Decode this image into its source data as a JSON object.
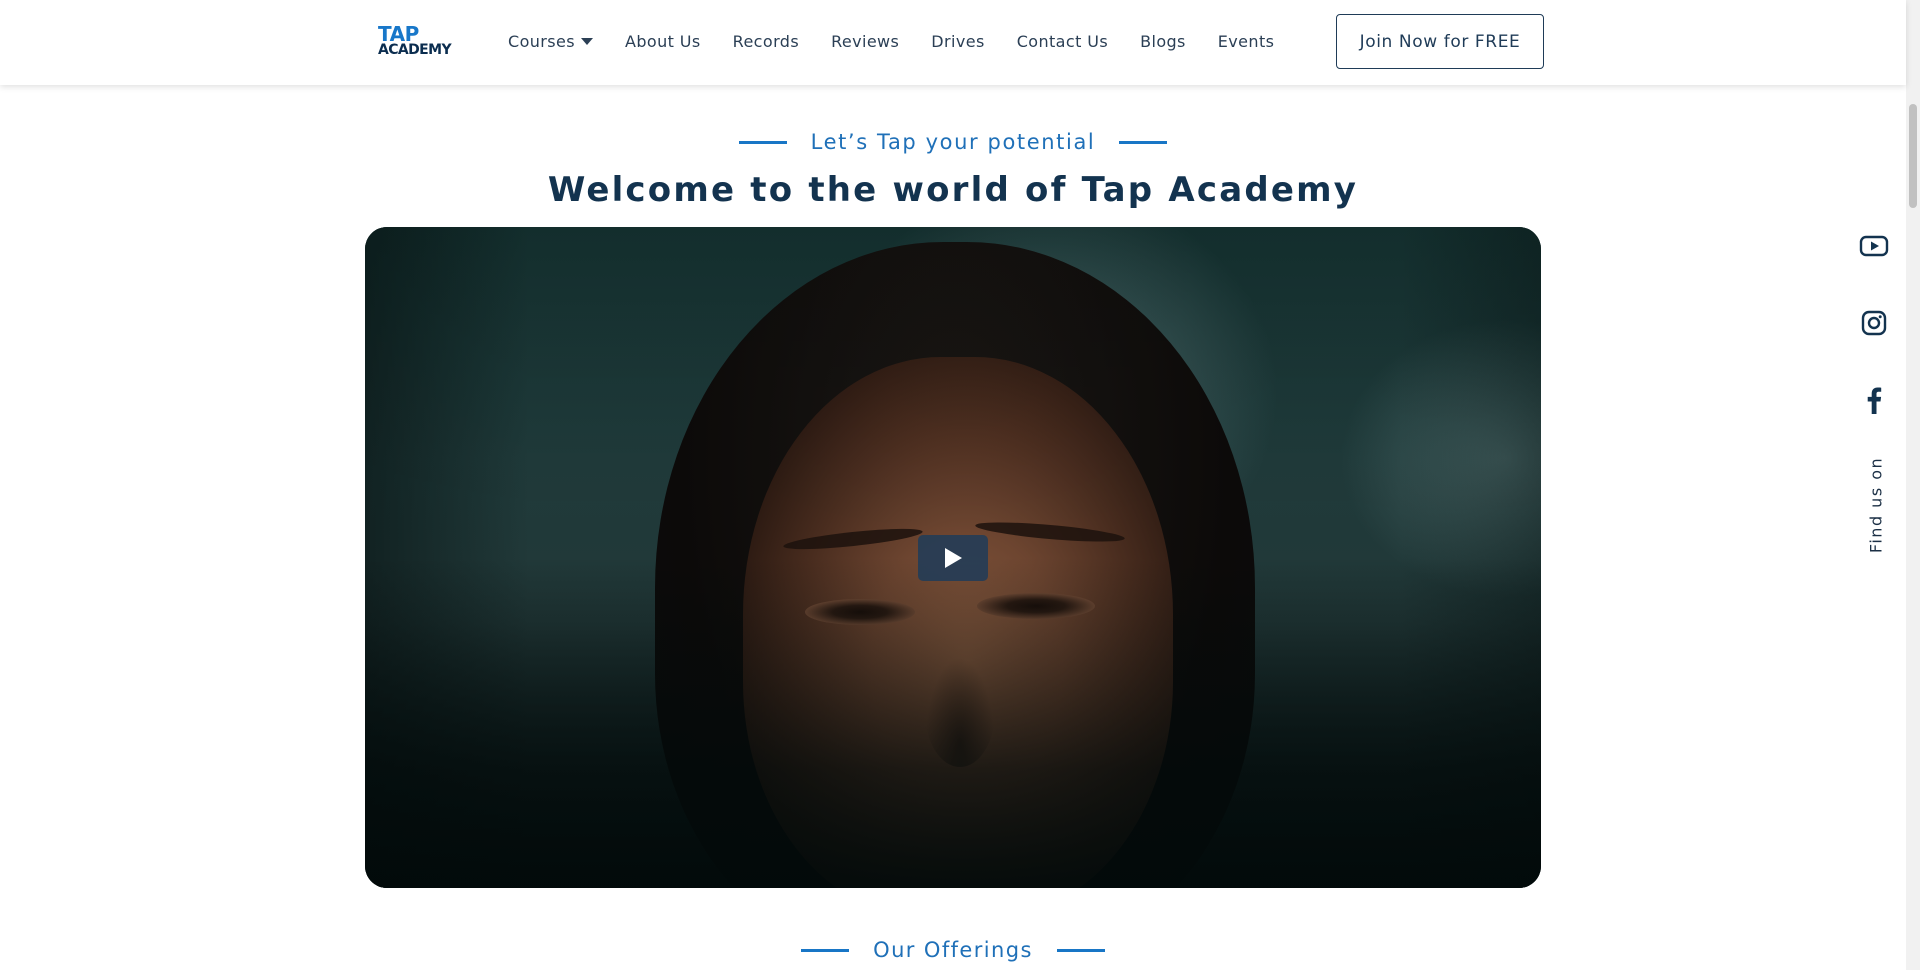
{
  "brand": {
    "logo_top": "TAP",
    "logo_bottom": "ACADEMY",
    "primary_color": "#1876c6",
    "dark_color": "#13334f"
  },
  "nav": {
    "items": [
      {
        "label": "Courses",
        "has_dropdown": true,
        "icon": "chevron-down-icon"
      },
      {
        "label": "About Us"
      },
      {
        "label": "Records"
      },
      {
        "label": "Reviews"
      },
      {
        "label": "Drives"
      },
      {
        "label": "Contact Us"
      },
      {
        "label": "Blogs"
      },
      {
        "label": "Events"
      }
    ],
    "cta_label": "Join Now for FREE"
  },
  "hero": {
    "eyebrow": "Let’s Tap your potential",
    "title": "Welcome to the world of Tap Academy",
    "video": {
      "play_icon": "play-icon"
    }
  },
  "offerings": {
    "heading": "Our Offerings"
  },
  "social": {
    "label": "Find us on",
    "icons": [
      "youtube-icon",
      "instagram-icon",
      "facebook-icon"
    ]
  }
}
